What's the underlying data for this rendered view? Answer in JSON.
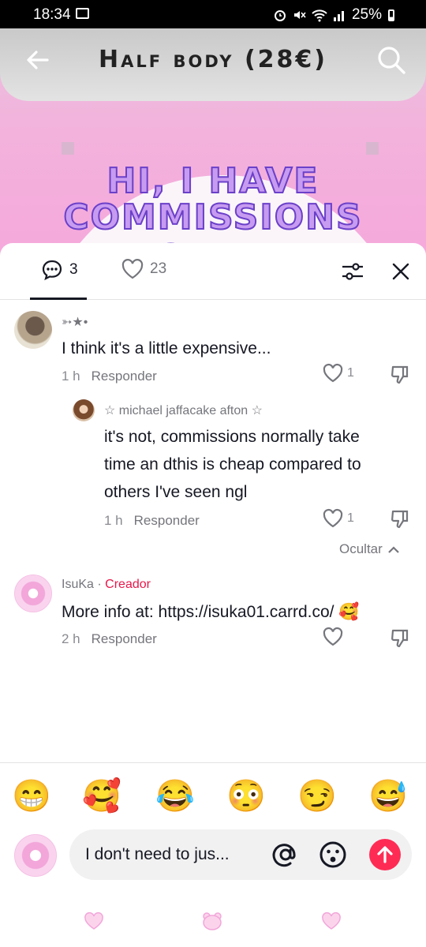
{
  "status_bar": {
    "time": "18:34",
    "battery": "25%"
  },
  "header": {
    "title": "Half body (28€)"
  },
  "video": {
    "promo_line1": "HI, I HAVE",
    "promo_line2": "COMMISSIONS OPEN"
  },
  "tabs": {
    "comments_count": "3",
    "likes_count": "23"
  },
  "comments": [
    {
      "username": "➳★•",
      "text": "I think it's a little expensive...",
      "time": "1 h",
      "reply_label": "Responder",
      "likes": "1"
    },
    {
      "username": "☆ michael jaffacake afton ☆",
      "text_line1": "it's not, commissions normally take",
      "text_line2": "time an dthis is cheap compared to",
      "text_line3": "others I've seen ngl",
      "time": "1 h",
      "reply_label": "Responder",
      "likes": "1"
    },
    {
      "username": "IsuKa",
      "creator_label": "Creador",
      "text": "More info at: https://isuka01.carrd.co/ 🥰",
      "time": "2 h",
      "reply_label": "Responder"
    }
  ],
  "hide_label": "Ocultar",
  "emojis": [
    "😁",
    "🥰",
    "😂",
    "😳",
    "😏",
    "😅"
  ],
  "input": {
    "text": "I don't need to jus..."
  },
  "colors": {
    "accent": "#fe2c55",
    "creator": "#e8174a",
    "promo": "#c79bf0"
  }
}
